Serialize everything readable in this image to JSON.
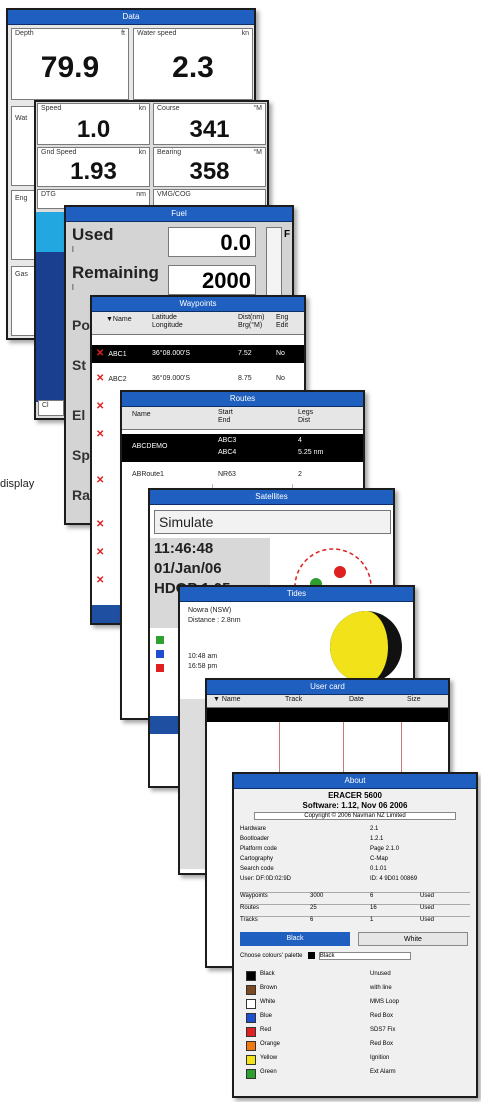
{
  "side_caption": "display",
  "data_panel": {
    "title": "Data",
    "depth_label": "Depth",
    "depth_unit": "ft",
    "depth_value": "79.9",
    "water_speed_label": "Water speed",
    "water_speed_unit": "kn",
    "water_speed_value": "2.3",
    "left_labels": [
      "Wat",
      "Eng",
      "Gas"
    ]
  },
  "nav_panel": {
    "speed_label": "Speed",
    "speed_unit": "kn",
    "speed_value": "1.0",
    "course_label": "Course",
    "course_unit": "°M",
    "course_value": "341",
    "sog_label": "Gnd Speed",
    "sog_unit": "kn",
    "sog_value": "1.93",
    "bearing_label": "Bearing",
    "bearing_unit": "°M",
    "bearing_value": "358",
    "dtg_label": "DTG",
    "dtg_unit": "nm",
    "vmg_label": "VMG/COG",
    "bottom_left": "Cl"
  },
  "fuel_panel": {
    "title": "Fuel",
    "used_label": "Used",
    "used_unit": "l",
    "used_value": "0.0",
    "remaining_label": "Remaining",
    "remaining_unit": "l",
    "remaining_value": "2000",
    "gauge_letter": "F",
    "left_labels": [
      "Po",
      "St",
      "El",
      "Sp",
      "Ra"
    ]
  },
  "waypoints_panel": {
    "title": "Waypoints",
    "headers": [
      "▼Name",
      "Latitude\nLongitude",
      "Dist(nm)\nBrg(°M)",
      "Eng\nEdit"
    ],
    "rows": [
      {
        "name": "ABC1",
        "lat": "36°08.000'S",
        "dist": "7.52",
        "e": "No",
        "selected": true
      },
      {
        "name": "ABC2",
        "lat": "36°09.000'S",
        "dist": "8.75",
        "e": "No",
        "selected": false
      }
    ]
  },
  "routes_panel": {
    "title": "Routes",
    "headers": [
      "Name",
      "Start\nEnd",
      "Legs\nDist"
    ],
    "rows": [
      {
        "name": "ABCDEMO",
        "start": "ABC3",
        "legs": "4",
        "selected": true
      },
      {
        "name": "",
        "start": "ABC4",
        "legs": "5.25 nm",
        "selected": true
      },
      {
        "name": "ABRoute1",
        "start": "NR63",
        "legs": "2",
        "selected": false
      }
    ]
  },
  "satellites_panel": {
    "title": "Satellites",
    "mode": "Simulate",
    "time": "11:46:48",
    "date": "01/Jan/06",
    "hdop": "HDOP 1.05"
  },
  "tides_panel": {
    "title": "Tides",
    "line1": "Nowra (NSW)",
    "line2": "Distance : 2.8nm",
    "line3": "10:48 am",
    "line4": "16:58 pm"
  },
  "user_card_panel": {
    "title": "User card",
    "headers": [
      "▼ Name",
      "Track",
      "Date",
      "Size"
    ]
  },
  "about_panel": {
    "title": "About",
    "model": "ERACER 5600",
    "software": "Software: 1.12, Nov 06 2006",
    "copyright": "Copyright © 2006 Navman NZ Limited",
    "info": [
      [
        "Hardware",
        "2.1"
      ],
      [
        "Bootloader",
        "1.2.1"
      ],
      [
        "Platform code",
        "Page 2.1.0"
      ],
      [
        "Cartography",
        "C-Map"
      ],
      [
        "Search code",
        "0.1.01"
      ],
      [
        "User: DF:0D:02:9D",
        "ID: 4 9D01 00869"
      ]
    ],
    "counts": [
      [
        "Waypoints",
        "3000",
        "6",
        "Used"
      ],
      [
        "Routes",
        "25",
        "16",
        "Used"
      ],
      [
        "Tracks",
        "6",
        "1",
        "Used"
      ]
    ],
    "tab_active": "Black",
    "tab_inactive": "White",
    "color_prompt": "Choose colours' palette",
    "color_selected": "Black",
    "colors": [
      {
        "name": "Black",
        "hex": "#000000",
        "val": "Unused"
      },
      {
        "name": "Brown",
        "hex": "#7a4a1e",
        "val": "with line"
      },
      {
        "name": "White",
        "hex": "#ffffff",
        "val": "MMS Loop"
      },
      {
        "name": "Blue",
        "hex": "#1f4fd0",
        "val": "Red Box"
      },
      {
        "name": "Red",
        "hex": "#e02020",
        "val": "SDS7 Fix"
      },
      {
        "name": "Orange",
        "hex": "#f07a10",
        "val": "Red Box"
      },
      {
        "name": "Yellow",
        "hex": "#f2e21a",
        "val": "Ignition"
      },
      {
        "name": "Green",
        "hex": "#2fa02f",
        "val": "Ext Alarm"
      }
    ]
  },
  "colors": {
    "titlebar": "#1f5fbf",
    "selection": "#000000",
    "tide_sun": "#f2e21a"
  }
}
